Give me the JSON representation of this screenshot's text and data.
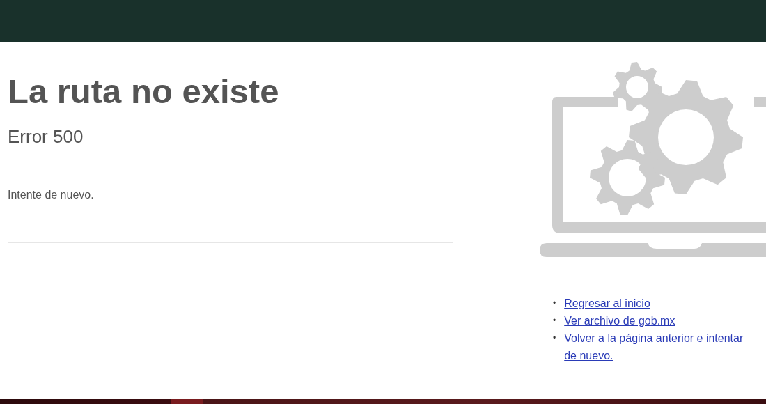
{
  "title": "La ruta no existe",
  "subtitle": "Error 500",
  "message": "Intente de nuevo.",
  "links": [
    {
      "bullet": "•",
      "label": "Regresar al inicio"
    },
    {
      "bullet": "•",
      "label": "Ver archivo de gob.mx"
    },
    {
      "bullet": "•",
      "label": "Volver a la página anterior e intentar de nuevo."
    }
  ]
}
